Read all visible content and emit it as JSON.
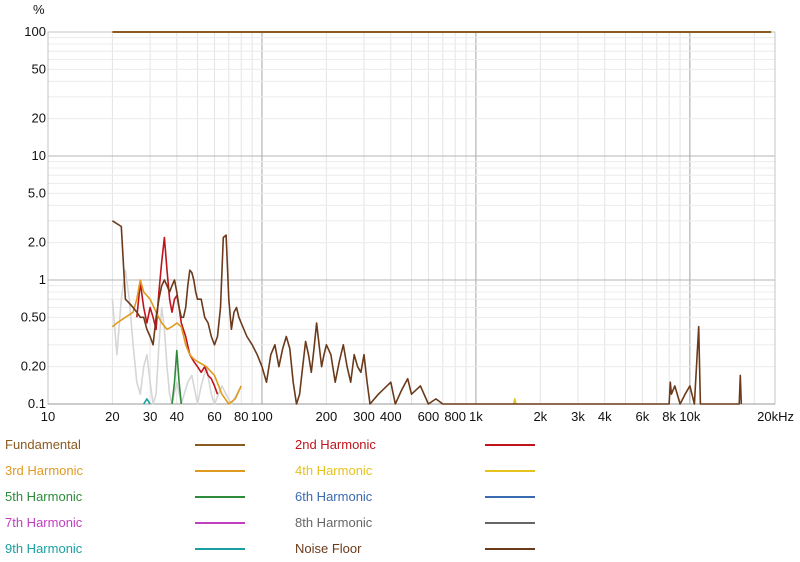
{
  "chart_data": {
    "type": "line",
    "title": "",
    "xlabel": "",
    "ylabel": "%",
    "x_scale": "log",
    "y_scale": "log",
    "xlim": [
      10,
      25000
    ],
    "ylim": [
      0.1,
      100
    ],
    "x_ticks": [
      {
        "v": 10,
        "label": "10"
      },
      {
        "v": 20,
        "label": "20"
      },
      {
        "v": 30,
        "label": "30"
      },
      {
        "v": 40,
        "label": "40"
      },
      {
        "v": 60,
        "label": "60"
      },
      {
        "v": 80,
        "label": "80"
      },
      {
        "v": 100,
        "label": "100"
      },
      {
        "v": 200,
        "label": "200"
      },
      {
        "v": 300,
        "label": "300"
      },
      {
        "v": 400,
        "label": "400"
      },
      {
        "v": 600,
        "label": "600"
      },
      {
        "v": 800,
        "label": "800"
      },
      {
        "v": 1000,
        "label": "1k"
      },
      {
        "v": 2000,
        "label": "2k"
      },
      {
        "v": 3000,
        "label": "3k"
      },
      {
        "v": 4000,
        "label": "4k"
      },
      {
        "v": 6000,
        "label": "6k"
      },
      {
        "v": 8000,
        "label": "8k"
      },
      {
        "v": 10000,
        "label": "10k"
      },
      {
        "v": 20000,
        "label": "20kHz"
      }
    ],
    "y_ticks": [
      {
        "v": 100,
        "label": "100"
      },
      {
        "v": 50,
        "label": "50"
      },
      {
        "v": 20,
        "label": "20"
      },
      {
        "v": 10,
        "label": "10"
      },
      {
        "v": 5,
        "label": "5.0"
      },
      {
        "v": 2,
        "label": "2.0"
      },
      {
        "v": 1,
        "label": "1"
      },
      {
        "v": 0.5,
        "label": "0.50"
      },
      {
        "v": 0.2,
        "label": "0.20"
      },
      {
        "v": 0.1,
        "label": "0.1"
      }
    ],
    "grid": true,
    "legend_position": "bottom",
    "series": [
      {
        "name": "Fundamental",
        "color": "#8a5a1e",
        "points": [
          [
            20,
            100
          ],
          [
            50,
            100
          ],
          [
            100,
            100
          ],
          [
            1000,
            100
          ],
          [
            10000,
            100
          ],
          [
            24000,
            100
          ]
        ]
      },
      {
        "name": "2nd Harmonic",
        "color": "#c0141c",
        "points": [
          [
            26,
            0.5
          ],
          [
            27,
            0.95
          ],
          [
            28,
            0.6
          ],
          [
            29,
            0.45
          ],
          [
            30,
            0.6
          ],
          [
            31,
            0.5
          ],
          [
            32,
            0.4
          ],
          [
            33,
            0.8
          ],
          [
            34,
            1.4
          ],
          [
            35,
            2.2
          ],
          [
            36,
            1.2
          ],
          [
            37,
            0.7
          ],
          [
            38,
            0.55
          ],
          [
            39,
            0.7
          ],
          [
            40,
            0.75
          ],
          [
            41,
            0.6
          ],
          [
            42,
            0.45
          ],
          [
            44,
            0.35
          ],
          [
            46,
            0.25
          ],
          [
            48,
            0.22
          ],
          [
            50,
            0.2
          ],
          [
            52,
            0.18
          ],
          [
            54,
            0.2
          ],
          [
            56,
            0.17
          ],
          [
            58,
            0.16
          ],
          [
            60,
            0.14
          ],
          [
            62,
            0.12
          ]
        ]
      },
      {
        "name": "3rd Harmonic",
        "color": "#e09a20",
        "points": [
          [
            20,
            0.42
          ],
          [
            21,
            0.45
          ],
          [
            23,
            0.5
          ],
          [
            25,
            0.55
          ],
          [
            26,
            0.7
          ],
          [
            27,
            1.0
          ],
          [
            28,
            0.8
          ],
          [
            30,
            0.7
          ],
          [
            32,
            0.55
          ],
          [
            34,
            0.45
          ],
          [
            36,
            0.4
          ],
          [
            38,
            0.42
          ],
          [
            40,
            0.45
          ],
          [
            42,
            0.42
          ],
          [
            44,
            0.3
          ],
          [
            46,
            0.25
          ],
          [
            48,
            0.23
          ],
          [
            50,
            0.22
          ],
          [
            55,
            0.2
          ],
          [
            60,
            0.17
          ],
          [
            65,
            0.12
          ],
          [
            70,
            0.1
          ],
          [
            75,
            0.11
          ],
          [
            80,
            0.14
          ]
        ]
      },
      {
        "name": "4th Harmonic",
        "color": "#e6c21c",
        "points": [
          [
            1500,
            0.1
          ],
          [
            1520,
            0.11
          ],
          [
            1540,
            0.1
          ]
        ]
      },
      {
        "name": "5th Harmonic",
        "color": "#2e8b3a",
        "points": [
          [
            38,
            0.1
          ],
          [
            39,
            0.15
          ],
          [
            40,
            0.27
          ],
          [
            41,
            0.15
          ],
          [
            42,
            0.1
          ]
        ]
      },
      {
        "name": "6th Harmonic",
        "color": "#3a6ab0",
        "points": []
      },
      {
        "name": "7th Harmonic",
        "color": "#c040c0",
        "points": []
      },
      {
        "name": "8th Harmonic",
        "color": "#666666",
        "points": []
      },
      {
        "name": "9th Harmonic",
        "color": "#1aa0a0",
        "points": [
          [
            28,
            0.1
          ],
          [
            29,
            0.11
          ],
          [
            30,
            0.1
          ]
        ]
      },
      {
        "name": "Noise Floor",
        "color": "#6b3a1a",
        "points": [
          [
            20,
            3.0
          ],
          [
            22,
            2.7
          ],
          [
            23,
            0.7
          ],
          [
            24,
            0.65
          ],
          [
            25,
            0.6
          ],
          [
            26,
            0.55
          ],
          [
            27,
            0.5
          ],
          [
            28,
            0.5
          ],
          [
            29,
            0.4
          ],
          [
            30,
            0.35
          ],
          [
            31,
            0.3
          ],
          [
            32,
            0.5
          ],
          [
            33,
            0.7
          ],
          [
            34,
            0.9
          ],
          [
            35,
            1.0
          ],
          [
            36,
            0.9
          ],
          [
            37,
            0.8
          ],
          [
            38,
            0.9
          ],
          [
            39,
            1.0
          ],
          [
            40,
            0.8
          ],
          [
            41,
            0.6
          ],
          [
            42,
            0.5
          ],
          [
            43,
            0.5
          ],
          [
            44,
            0.6
          ],
          [
            45,
            0.9
          ],
          [
            46,
            1.2
          ],
          [
            47,
            1.15
          ],
          [
            48,
            1.0
          ],
          [
            49,
            0.8
          ],
          [
            50,
            0.7
          ],
          [
            52,
            0.7
          ],
          [
            54,
            0.5
          ],
          [
            56,
            0.45
          ],
          [
            58,
            0.35
          ],
          [
            60,
            0.3
          ],
          [
            62,
            0.35
          ],
          [
            64,
            0.6
          ],
          [
            66,
            2.2
          ],
          [
            68,
            2.3
          ],
          [
            70,
            0.7
          ],
          [
            72,
            0.4
          ],
          [
            74,
            0.55
          ],
          [
            76,
            0.6
          ],
          [
            78,
            0.5
          ],
          [
            80,
            0.45
          ],
          [
            85,
            0.35
          ],
          [
            90,
            0.3
          ],
          [
            95,
            0.25
          ],
          [
            100,
            0.2
          ],
          [
            105,
            0.15
          ],
          [
            110,
            0.25
          ],
          [
            115,
            0.3
          ],
          [
            120,
            0.2
          ],
          [
            125,
            0.28
          ],
          [
            130,
            0.35
          ],
          [
            135,
            0.28
          ],
          [
            140,
            0.15
          ],
          [
            145,
            0.1
          ],
          [
            150,
            0.12
          ],
          [
            155,
            0.2
          ],
          [
            160,
            0.32
          ],
          [
            165,
            0.25
          ],
          [
            170,
            0.18
          ],
          [
            175,
            0.28
          ],
          [
            180,
            0.45
          ],
          [
            185,
            0.3
          ],
          [
            190,
            0.2
          ],
          [
            195,
            0.25
          ],
          [
            200,
            0.3
          ],
          [
            210,
            0.25
          ],
          [
            220,
            0.15
          ],
          [
            230,
            0.22
          ],
          [
            240,
            0.3
          ],
          [
            250,
            0.2
          ],
          [
            260,
            0.15
          ],
          [
            270,
            0.25
          ],
          [
            280,
            0.2
          ],
          [
            290,
            0.18
          ],
          [
            300,
            0.25
          ],
          [
            310,
            0.15
          ],
          [
            320,
            0.1
          ],
          [
            350,
            0.12
          ],
          [
            400,
            0.15
          ],
          [
            420,
            0.1
          ],
          [
            450,
            0.13
          ],
          [
            480,
            0.16
          ],
          [
            500,
            0.12
          ],
          [
            550,
            0.14
          ],
          [
            600,
            0.1
          ],
          [
            650,
            0.11
          ],
          [
            700,
            0.1
          ],
          [
            8000,
            0.1
          ],
          [
            8100,
            0.15
          ],
          [
            8200,
            0.12
          ],
          [
            8500,
            0.14
          ],
          [
            9000,
            0.1
          ],
          [
            9500,
            0.12
          ],
          [
            10000,
            0.14
          ],
          [
            10500,
            0.1
          ],
          [
            11000,
            0.42
          ],
          [
            11200,
            0.1
          ],
          [
            17000,
            0.1
          ],
          [
            17200,
            0.17
          ],
          [
            17400,
            0.1
          ]
        ]
      },
      {
        "name": "",
        "color": "#d6d6d6",
        "points": [
          [
            20,
            0.7
          ],
          [
            21,
            0.25
          ],
          [
            22,
            0.7
          ],
          [
            23,
            1.2
          ],
          [
            24,
            0.7
          ],
          [
            25,
            0.3
          ],
          [
            26,
            0.15
          ],
          [
            27,
            0.12
          ],
          [
            28,
            0.2
          ],
          [
            29,
            0.25
          ],
          [
            30,
            0.15
          ],
          [
            31,
            0.1
          ],
          [
            32,
            0.12
          ],
          [
            33,
            0.3
          ],
          [
            34,
            0.6
          ],
          [
            35,
            0.4
          ],
          [
            36,
            0.2
          ],
          [
            37,
            0.12
          ],
          [
            38,
            0.1
          ],
          [
            40,
            0.15
          ],
          [
            42,
            0.1
          ],
          [
            45,
            0.15
          ],
          [
            47,
            0.17
          ],
          [
            50,
            0.1
          ],
          [
            52,
            0.14
          ],
          [
            55,
            0.2
          ],
          [
            58,
            0.12
          ],
          [
            60,
            0.1
          ],
          [
            65,
            0.14
          ],
          [
            68,
            0.12
          ],
          [
            72,
            0.1
          ],
          [
            80,
            0.14
          ]
        ]
      }
    ],
    "legend": [
      {
        "label": "Fundamental",
        "color": "#8a5a1e"
      },
      {
        "label": "2nd Harmonic",
        "color": "#c0141c"
      },
      {
        "label": "3rd Harmonic",
        "color": "#e09a20"
      },
      {
        "label": "4th Harmonic",
        "color": "#e6c21c"
      },
      {
        "label": "5th Harmonic",
        "color": "#2e8b3a"
      },
      {
        "label": "6th Harmonic",
        "color": "#3a6ab0"
      },
      {
        "label": "7th Harmonic",
        "color": "#c040c0"
      },
      {
        "label": "8th Harmonic",
        "color": "#666666"
      },
      {
        "label": "9th Harmonic",
        "color": "#1aa0a0"
      },
      {
        "label": "Noise Floor",
        "color": "#6b3a1a"
      }
    ]
  }
}
